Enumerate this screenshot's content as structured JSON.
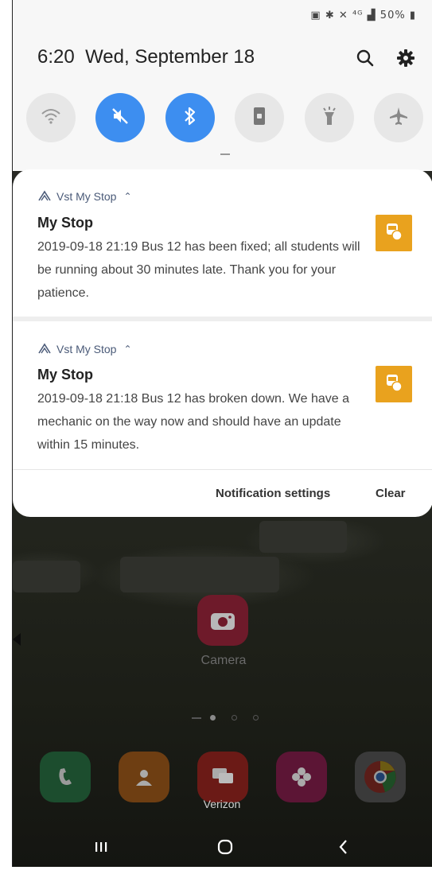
{
  "status_bar": {
    "icons_text": "N ✱ ✕ 4G ▮ 50%",
    "battery_level": "50%"
  },
  "quick_panel": {
    "time": "6:20",
    "date": "Wed, September 18",
    "tiles": [
      {
        "name": "wifi",
        "icon": "wifi-icon",
        "on": false
      },
      {
        "name": "sound",
        "icon": "mute-icon",
        "on": true
      },
      {
        "name": "bluetooth",
        "icon": "bluetooth-icon",
        "on": true
      },
      {
        "name": "rotation-lock",
        "icon": "portrait-lock-icon",
        "on": false
      },
      {
        "name": "flashlight",
        "icon": "flashlight-icon",
        "on": false
      },
      {
        "name": "airplane-mode",
        "icon": "airplane-icon",
        "on": false
      }
    ]
  },
  "notifications": [
    {
      "app_name": "Vst My Stop",
      "title": "My Stop",
      "body": "2019-09-18 21:19 Bus 12 has been fixed; all students will be running about 30 minutes late. Thank you for your patience."
    },
    {
      "app_name": "Vst My Stop",
      "title": "My Stop",
      "body": "2019-09-18 21:18 Bus 12 has broken down. We have a mechanic on the way now and should have an update within 15 minutes."
    }
  ],
  "notification_footer": {
    "settings_label": "Notification settings",
    "clear_label": "Clear"
  },
  "home": {
    "camera_label": "Camera",
    "dock_label": "Verizon"
  },
  "colors": {
    "accent": "#3d8ef0",
    "app_thumb": "#e9a21e"
  }
}
